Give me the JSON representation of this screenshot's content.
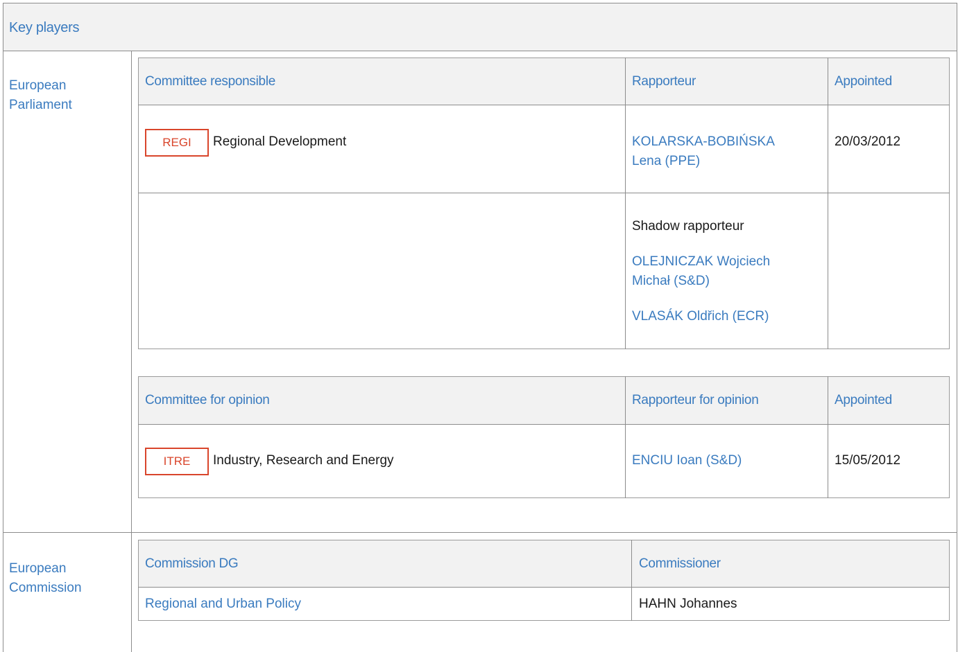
{
  "title": "Key players",
  "parliament": {
    "label_line1": "European",
    "label_line2": "Parliament",
    "responsible": {
      "headers": {
        "committee": "Committee responsible",
        "rapporteur": "Rapporteur",
        "appointed": "Appointed"
      },
      "row": {
        "code": "REGI",
        "name": "Regional Development",
        "rapporteur_line1": "KOLARSKA-BOBIŃSKA",
        "rapporteur_line2": "Lena (PPE)",
        "appointed": "20/03/2012"
      },
      "shadow": {
        "label": "Shadow rapporteur",
        "items": [
          {
            "line1": "OLEJNICZAK Wojciech",
            "line2": "Michał (S&D)"
          },
          {
            "line1": "VLASÁK Oldřich (ECR)"
          }
        ]
      }
    },
    "opinion": {
      "headers": {
        "committee": "Committee for opinion",
        "rapporteur": "Rapporteur for opinion",
        "appointed": "Appointed"
      },
      "row": {
        "code": "ITRE",
        "name": "Industry, Research and Energy",
        "rapporteur": "ENCIU Ioan (S&D)",
        "appointed": "15/05/2012"
      }
    }
  },
  "commission": {
    "label_line1": "European",
    "label_line2": "Commission",
    "headers": {
      "dg": "Commission DG",
      "commissioner": "Commissioner"
    },
    "row": {
      "dg": "Regional and Urban Policy",
      "commissioner": "HAHN Johannes"
    }
  },
  "colors": {
    "accent": "#3a7bbf",
    "tag": "#d9452b",
    "header_bg": "#f2f2f2"
  }
}
